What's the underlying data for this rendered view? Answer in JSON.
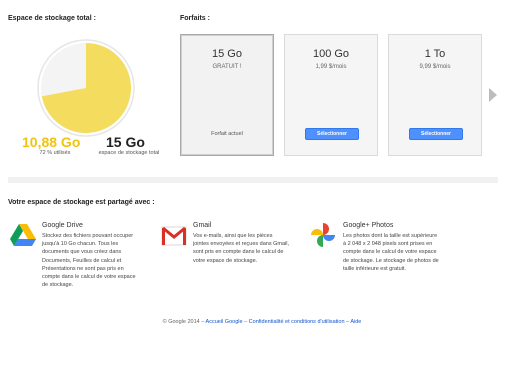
{
  "storage": {
    "title": "Espace de stockage total :",
    "used_value": "10,88 Go",
    "used_percent_label": "72 % utilisés",
    "used_fraction": 0.72,
    "total_value": "15 Go",
    "total_label": "espace de stockage total",
    "used_color": "#f4dc5e",
    "free_color": "#f4f4f4"
  },
  "plans": {
    "title": "Forfaits :",
    "items": [
      {
        "size": "15 Go",
        "price": "GRATUIT !",
        "current_label": "Forfait actuel"
      },
      {
        "size": "100 Go",
        "price": "1,99 $/mois",
        "button_label": "Sélectionner"
      },
      {
        "size": "1 To",
        "price": "9,99 $/mois",
        "button_label": "Sélectionner"
      }
    ]
  },
  "shared": {
    "title": "Votre espace de stockage est partagé avec :",
    "services": [
      {
        "name": "Google Drive",
        "icon": "google-drive-icon",
        "lines": [
          "Stockez des fichiers pouvant occuper",
          "jusqu'à 10 Go chacun. Tous les",
          "documents que vous créez dans",
          "Documents, Feuilles de calcul et",
          "Présentations ne sont pas pris en",
          "compte dans le calcul de votre espace",
          "de stockage."
        ]
      },
      {
        "name": "Gmail",
        "icon": "gmail-icon",
        "lines": [
          "Vos e-mails, ainsi que les pièces",
          "jointes envoyées et reçues dans Gmail,",
          "sont pris en compte dans le calcul de",
          "votre espace de stockage."
        ]
      },
      {
        "name": "Google+ Photos",
        "icon": "google-photos-icon",
        "lines": [
          "Les photos dont la taille est supérieure",
          "à 2 048 x 2 048 pixels sont prises en",
          "compte dans le calcul de votre espace",
          "de stockage. Le stockage de photos de",
          "taille inférieure est gratuit."
        ]
      }
    ]
  },
  "footer": {
    "copyright": "© Google 2014",
    "sep": " – ",
    "link_home": "Accueil Google",
    "link_terms": "Confidentialité et conditions d'utilisation",
    "link_help": "Aide"
  }
}
